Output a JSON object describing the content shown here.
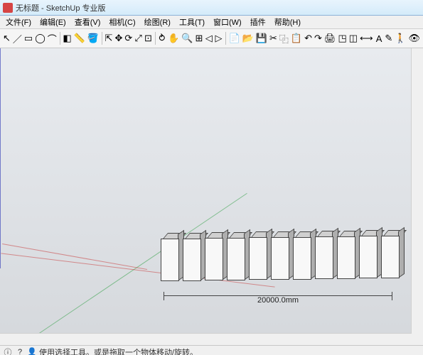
{
  "title": "无标题 - SketchUp 专业版",
  "menu": {
    "file": "文件(F)",
    "edit": "编辑(E)",
    "view": "查看(V)",
    "camera": "相机(C)",
    "draw": "绘图(R)",
    "tools": "工具(T)",
    "window": "窗口(W)",
    "plugins": "插件",
    "help": "帮助(H)"
  },
  "status": {
    "hint": "使用选择工具。或是拖取一个物体移动/旋转。"
  },
  "viewport": {
    "dimension_label": "20000.0mm",
    "box_count": 11
  },
  "icons": {
    "select": "↖",
    "line": "／",
    "rect": "▭",
    "circle": "◯",
    "arc": "⌒",
    "eraser": "◧",
    "tape": "📏",
    "push": "⇱",
    "move": "✥",
    "rotate": "⟳",
    "scale": "⤢",
    "offset": "⊡",
    "orbit": "⥁",
    "pan": "✋",
    "zoom": "🔍",
    "zoomx": "⊞",
    "prev": "◁",
    "next": "▷",
    "paint": "🪣",
    "section": "◫",
    "dim": "⟷",
    "text": "A",
    "label": "✎",
    "walk": "🚶",
    "look": "👁",
    "new": "📄",
    "open": "📂",
    "save": "💾",
    "cut": "✂",
    "copy": "⿻",
    "paste": "📋",
    "undo": "↶",
    "redo": "↷",
    "print": "🖨",
    "model": "◳"
  }
}
